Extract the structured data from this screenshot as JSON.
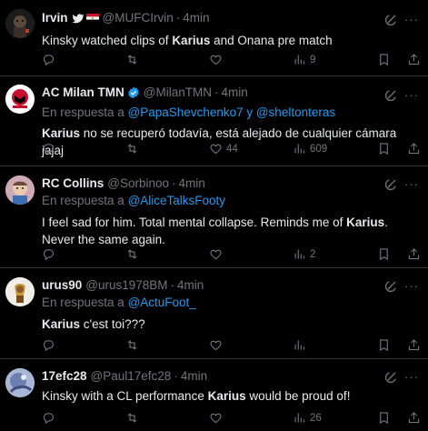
{
  "colors": {
    "background": "#000000",
    "text": "#e7e9ea",
    "muted": "#71767b",
    "link": "#1d9bf0",
    "divider": "#2f3336",
    "verified": "#1d9bf0"
  },
  "tweets": [
    {
      "display_name": "Irvin",
      "badges": [
        "twitter-bird-icon",
        "egypt-flag-icon"
      ],
      "handle": "@MUFCIrvin",
      "time": "4min",
      "reply_prefix": "",
      "reply_to": "",
      "text_parts": [
        {
          "t": "Kinsky watched clips of ",
          "b": false
        },
        {
          "t": "Karius",
          "b": true
        },
        {
          "t": " and Onana pre match",
          "b": false
        }
      ],
      "counts": {
        "replies": "",
        "retweets": "",
        "likes": "",
        "views": "9"
      }
    },
    {
      "display_name": "AC Milan TMN",
      "badges": [
        "verified-badge-icon"
      ],
      "handle": "@MilanTMN",
      "time": "4min",
      "reply_prefix": "En respuesta a ",
      "reply_to": "@PapaShevchenko7 y @sheltonteras",
      "text_parts": [
        {
          "t": "Karius",
          "b": true
        },
        {
          "t": " no se recuperó todavía, está alejado de cualquier cámara jajaj",
          "b": false
        }
      ],
      "counts": {
        "replies": "",
        "retweets": "",
        "likes": "44",
        "views": "609"
      }
    },
    {
      "display_name": "RC Collins",
      "badges": [],
      "handle": "@Sorbinoo",
      "time": "4min",
      "reply_prefix": "En respuesta a ",
      "reply_to": "@AliceTalksFooty",
      "text_parts": [
        {
          "t": "I feel sad for him. Total mental collapse. Reminds me of ",
          "b": false
        },
        {
          "t": "Karius",
          "b": true
        },
        {
          "t": ". Never the same again.",
          "b": false
        }
      ],
      "counts": {
        "replies": "",
        "retweets": "",
        "likes": "",
        "views": "2"
      }
    },
    {
      "display_name": "urus90",
      "badges": [],
      "handle": "@urus1978BM",
      "time": "4min",
      "reply_prefix": "En respuesta a ",
      "reply_to": "@ActuFoot_",
      "text_parts": [
        {
          "t": "Karius",
          "b": true
        },
        {
          "t": " c'est toi???",
          "b": false
        }
      ],
      "counts": {
        "replies": "",
        "retweets": "",
        "likes": "",
        "views": ""
      }
    },
    {
      "display_name": "17efc28",
      "badges": [],
      "handle": "@Paul17efc28",
      "time": "4min",
      "reply_prefix": "",
      "reply_to": "",
      "text_parts": [
        {
          "t": "Kinsky with a CL performance ",
          "b": false
        },
        {
          "t": "Karius",
          "b": true
        },
        {
          "t": " would be proud of!",
          "b": false
        }
      ],
      "counts": {
        "replies": "",
        "retweets": "",
        "likes": "",
        "views": "26"
      }
    }
  ],
  "dot": "·",
  "more_glyph": "···"
}
